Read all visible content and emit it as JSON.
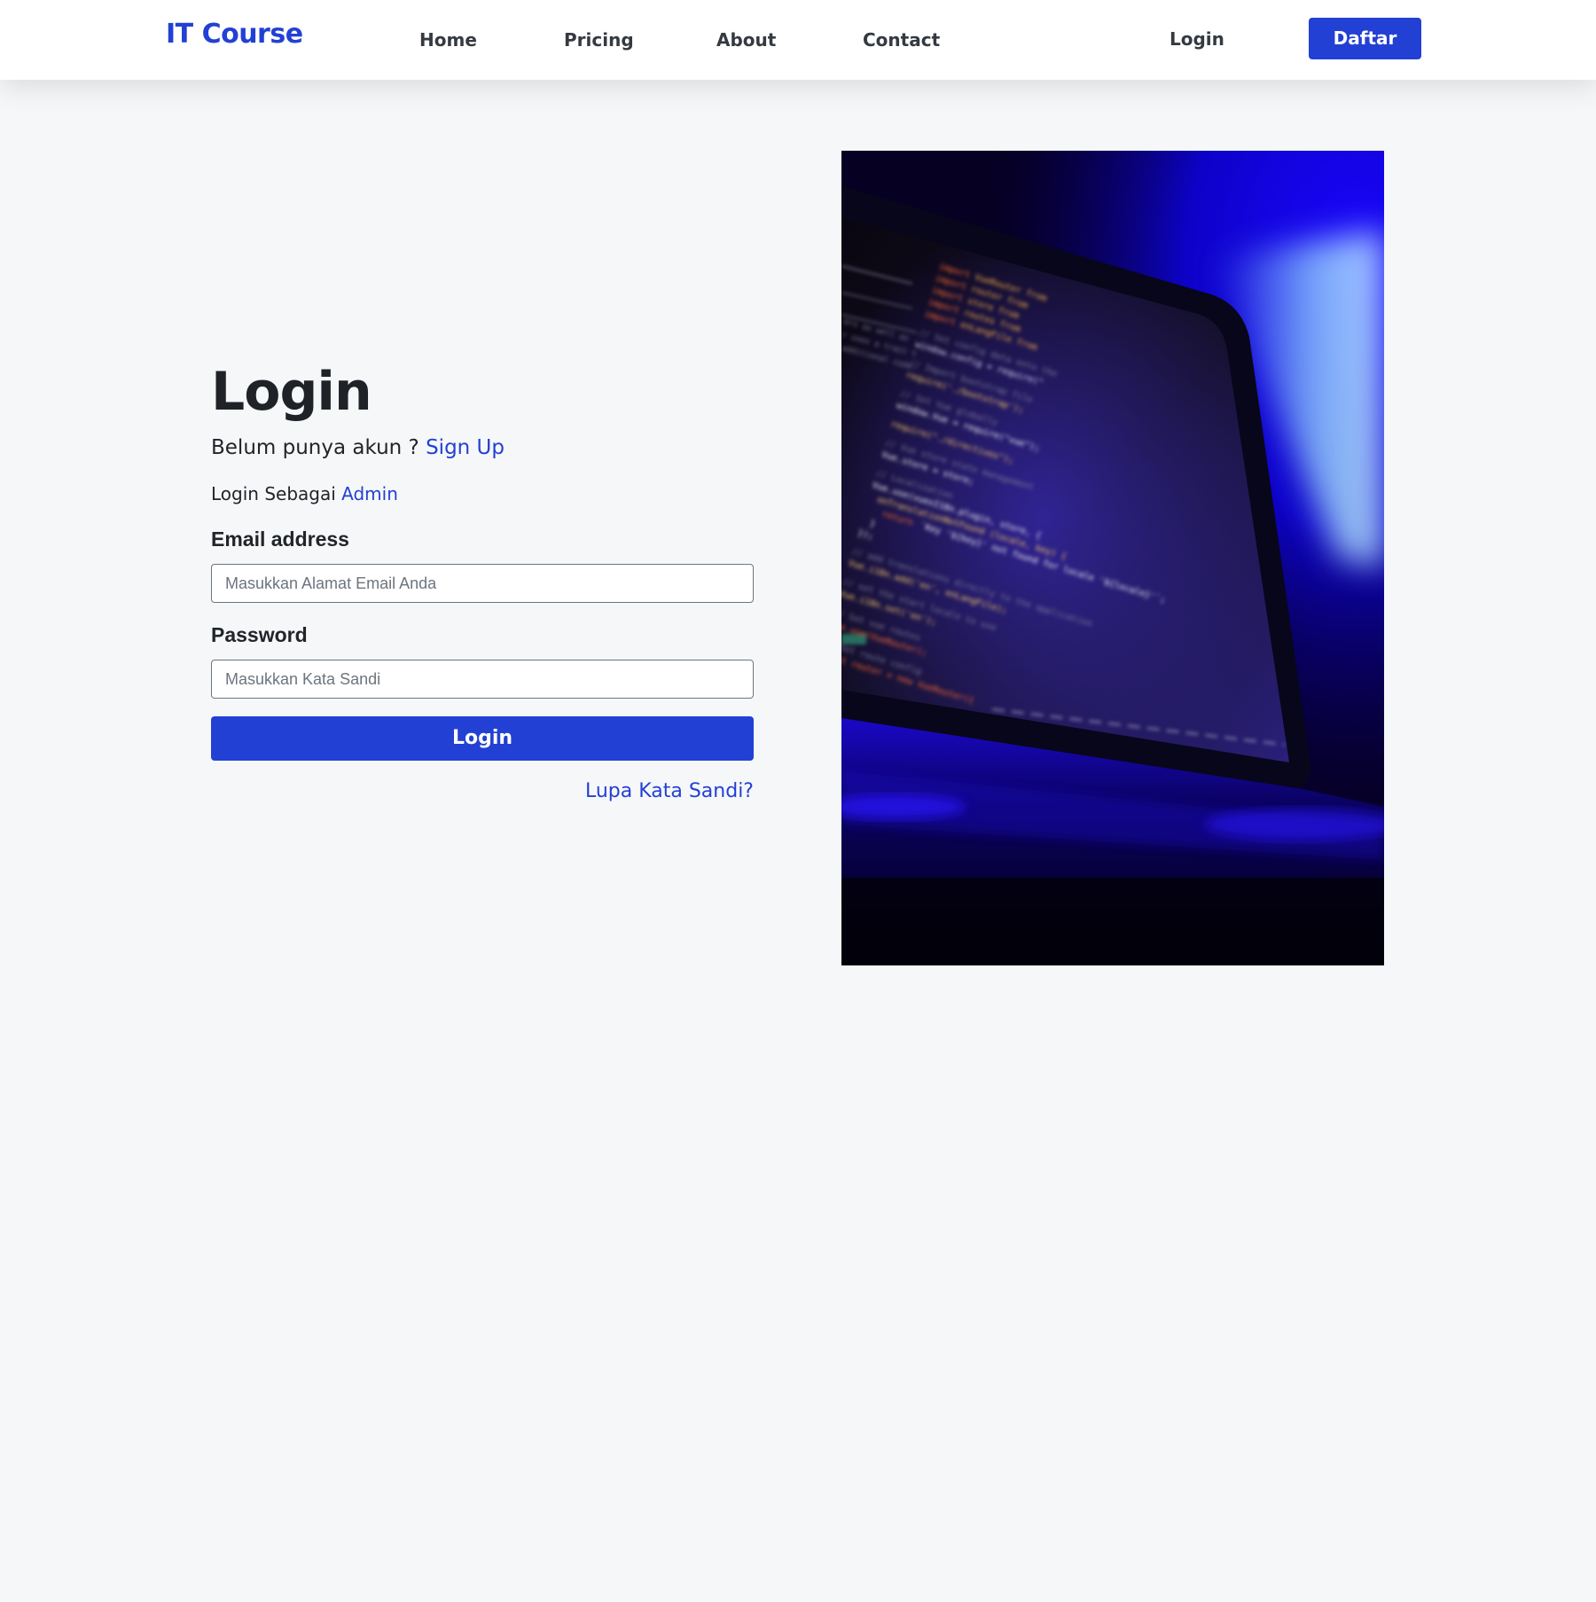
{
  "navbar": {
    "brand": "IT Course",
    "links": [
      {
        "label": "Home"
      },
      {
        "label": "Pricing"
      },
      {
        "label": "About"
      },
      {
        "label": "Contact"
      }
    ],
    "login_label": "Login",
    "register_label": "Daftar"
  },
  "login_form": {
    "title": "Login",
    "no_account_text": "Belum punya akun ?",
    "signup_link": "Sign Up",
    "login_as_text": "Login Sebagai",
    "admin_link": "Admin",
    "email_label": "Email address",
    "email_placeholder": "Masukkan Alamat Email Anda",
    "email_value": "",
    "password_label": "Password",
    "password_placeholder": "Masukkan Kata Sandi",
    "password_value": "",
    "submit_label": "Login",
    "forgot_link": "Lupa Kata Sandi?"
  },
  "colors": {
    "accent": "#2340d4",
    "background": "#f6f7f9",
    "navbar": "#ffffff",
    "text": "#212529"
  },
  "hero_image": {
    "description_icon": "laptop-code-photo"
  }
}
